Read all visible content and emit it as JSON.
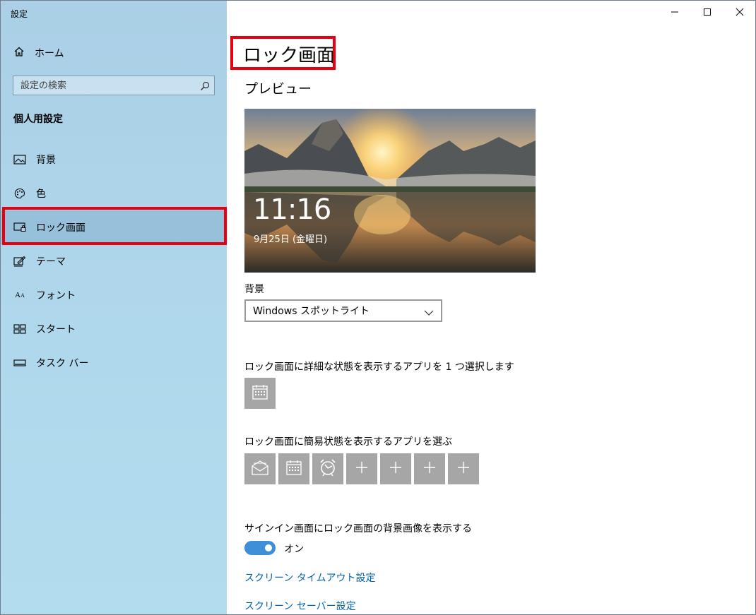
{
  "window": {
    "title": "設定"
  },
  "titlebar": {
    "minimize": "—",
    "maximize": "☐",
    "close": "✕"
  },
  "sidebar": {
    "home_label": "ホーム",
    "search_placeholder": "設定の検索",
    "section_title": "個人用設定",
    "items": [
      {
        "label": "背景",
        "icon": "image-icon"
      },
      {
        "label": "色",
        "icon": "palette-icon"
      },
      {
        "label": "ロック画面",
        "icon": "lock-screen-icon",
        "selected": true
      },
      {
        "label": "テーマ",
        "icon": "theme-icon"
      },
      {
        "label": "フォント",
        "icon": "font-icon",
        "icon_text": "A"
      },
      {
        "label": "スタート",
        "icon": "start-icon"
      },
      {
        "label": "タスク バー",
        "icon": "taskbar-icon"
      }
    ]
  },
  "main": {
    "title": "ロック画面",
    "preview_label": "プレビュー",
    "preview_time": "11:16",
    "preview_date": "9月25日 (金曜日)",
    "background_label": "背景",
    "background_value": "Windows スポットライト",
    "detail_app_label": "ロック画面に詳細な状態を表示するアプリを 1 つ選択します",
    "detail_app_icon": "calendar-icon",
    "quick_apps_label": "ロック画面に簡易状態を表示するアプリを選ぶ",
    "quick_apps": [
      "mail-icon",
      "calendar-icon",
      "alarm-clock-icon",
      "plus-icon",
      "plus-icon",
      "plus-icon",
      "plus-icon"
    ],
    "signin_label": "サインイン画面にロック画面の背景画像を表示する",
    "signin_toggle": "オン",
    "links": [
      "スクリーン タイムアウト設定",
      "スクリーン セーバー設定"
    ]
  },
  "colors": {
    "accent": "#0063b1",
    "toggle": "#3f8fd8",
    "highlight": "#e60012",
    "tile": "#a6a6a6"
  }
}
